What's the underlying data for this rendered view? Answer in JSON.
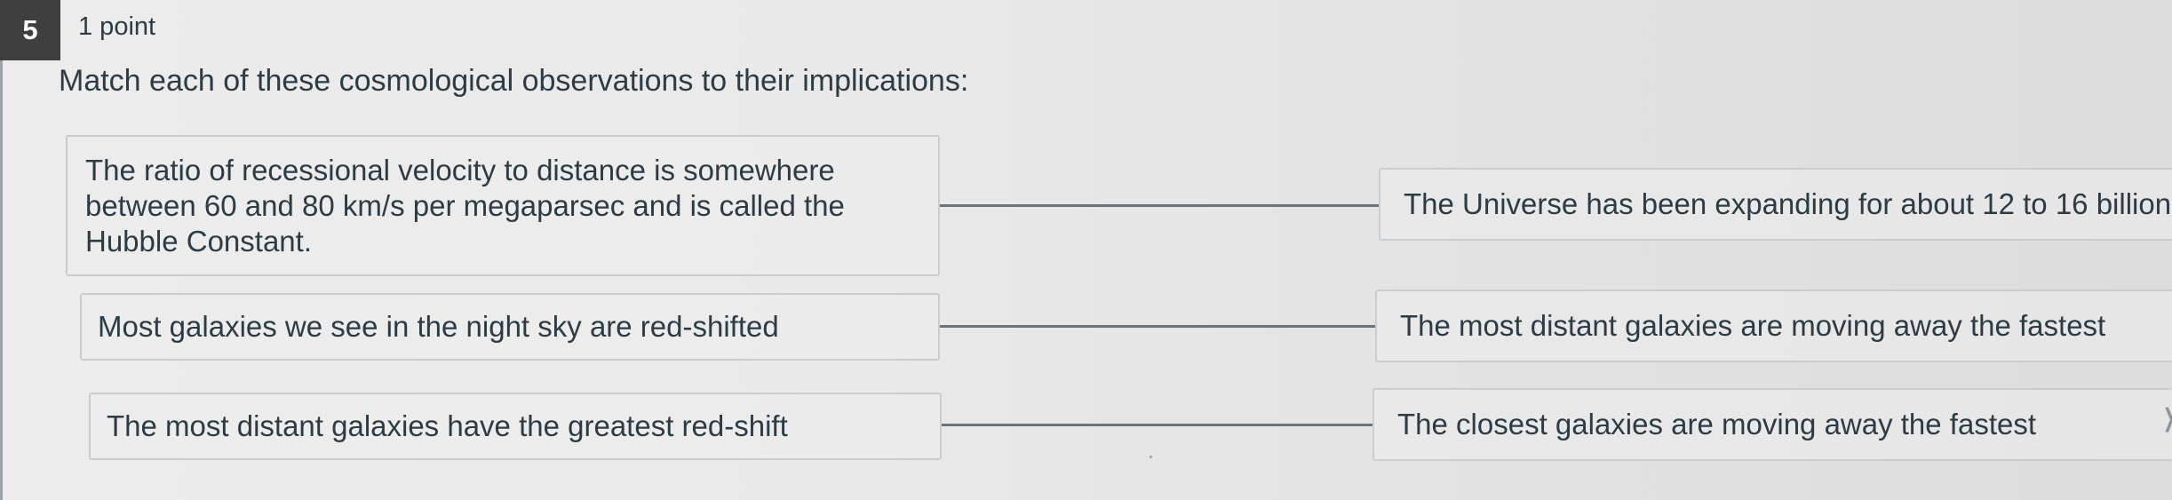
{
  "question": {
    "number": "5",
    "points": "1 point",
    "prompt": "Match each of these cosmological observations to their implications:"
  },
  "pairs": [
    {
      "observation": "The ratio of recessional velocity to distance is somewhere between 60 and 80 km/s per megaparsec and is called the Hubble Constant.",
      "implication": "The Universe has been expanding for about 12 to 16 billion"
    },
    {
      "observation": "Most galaxies we see in the night sky are red-shifted",
      "implication": "The most distant galaxies are moving away the fastest"
    },
    {
      "observation": "The most distant galaxies have the greatest red-shift",
      "implication": "The closest galaxies are moving away the fastest"
    }
  ],
  "icons": {
    "dropdown": "chevron-right-icon"
  }
}
